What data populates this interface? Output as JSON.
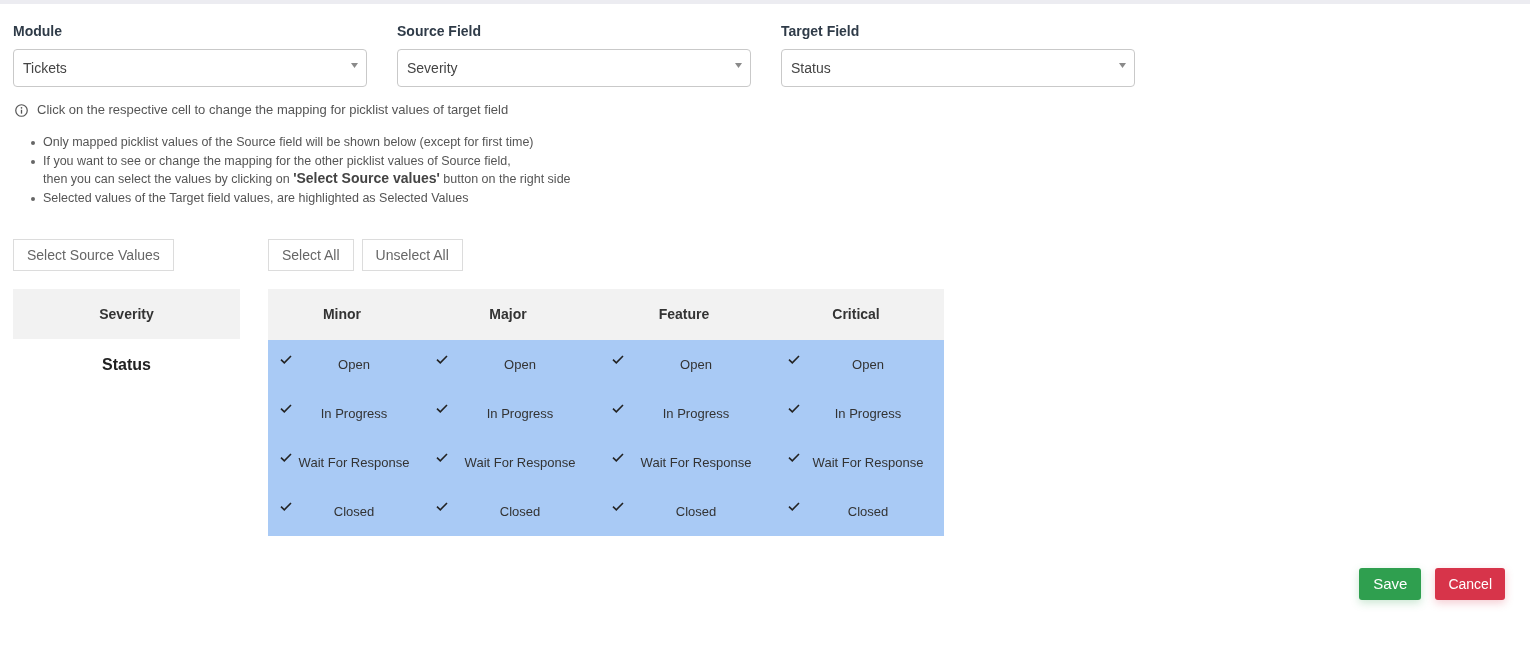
{
  "filters": [
    {
      "label": "Module",
      "value": "Tickets"
    },
    {
      "label": "Source Field",
      "value": "Severity"
    },
    {
      "label": "Target Field",
      "value": "Status"
    }
  ],
  "info": "Click on the respective cell to change the mapping for picklist values of target field",
  "notes": [
    "Only mapped picklist values of the Source field will be shown below (except for first time)",
    "If you want to see or change the mapping for the other picklist values of Source field,\nthen you can select the values by clicking on **'Select Source values'** button on the right side",
    "Selected values of the Target field values, are highlighted as Selected Values"
  ],
  "source_button": "Select Source Values",
  "bulk_buttons": [
    "Select All",
    "Unselect All"
  ],
  "source_header": "Severity",
  "target_label": "Status",
  "mapping": {
    "columns": [
      "Minor",
      "Major",
      "Feature",
      "Critical"
    ],
    "rows": [
      {
        "cells": [
          {
            "value": "Open",
            "selected": true
          },
          {
            "value": "Open",
            "selected": true
          },
          {
            "value": "Open",
            "selected": true
          },
          {
            "value": "Open",
            "selected": true
          }
        ]
      },
      {
        "cells": [
          {
            "value": "In Progress",
            "selected": true
          },
          {
            "value": "In Progress",
            "selected": true
          },
          {
            "value": "In Progress",
            "selected": true
          },
          {
            "value": "In Progress",
            "selected": true
          }
        ]
      },
      {
        "cells": [
          {
            "value": "Wait For Response",
            "selected": true
          },
          {
            "value": "Wait For Response",
            "selected": true
          },
          {
            "value": "Wait For Response",
            "selected": true
          },
          {
            "value": "Wait For Response",
            "selected": true
          }
        ]
      },
      {
        "cells": [
          {
            "value": "Closed",
            "selected": true
          },
          {
            "value": "Closed",
            "selected": true
          },
          {
            "value": "Closed",
            "selected": true
          },
          {
            "value": "Closed",
            "selected": true
          }
        ]
      }
    ]
  },
  "actions": [
    {
      "label": "Save",
      "kind": "primary"
    },
    {
      "label": "Cancel",
      "kind": "danger"
    }
  ]
}
